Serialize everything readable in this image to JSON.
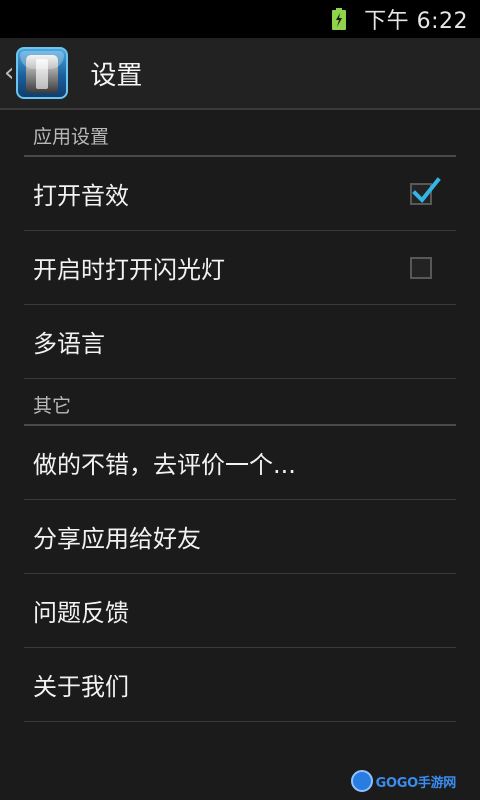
{
  "status_bar": {
    "time": "下午 6:22",
    "battery_icon": "battery-charging-icon",
    "battery_color": "#8fd44a"
  },
  "action_bar": {
    "title": "设置",
    "back_icon": "chevron-left-icon",
    "app_icon": "flashlight-app-icon"
  },
  "sections": [
    {
      "header": "应用设置",
      "items": [
        {
          "label": "打开音效",
          "has_checkbox": true,
          "checked": true
        },
        {
          "label": "开启时打开闪光灯",
          "has_checkbox": true,
          "checked": false
        },
        {
          "label": "多语言",
          "has_checkbox": false
        }
      ]
    },
    {
      "header": "其它",
      "items": [
        {
          "label": "做的不错，去评价一个..."
        },
        {
          "label": "分享应用给好友"
        },
        {
          "label": "问题反馈"
        },
        {
          "label": "关于我们"
        }
      ]
    }
  ],
  "accent_color": "#33b5e5",
  "watermark": {
    "text": "GOGO手游网",
    "icon": "gogo-logo-icon"
  }
}
